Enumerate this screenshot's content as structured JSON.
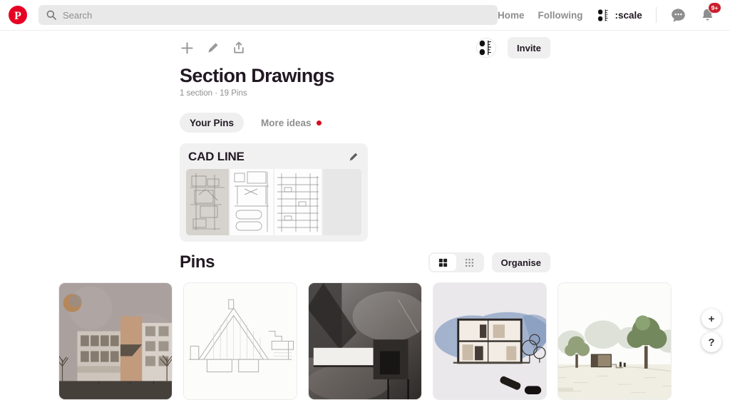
{
  "colors": {
    "brand_red": "#e60023",
    "badge_red": "#ca1f2e",
    "new_dot_red": "#d50c22",
    "icon_gray": "#8e8e8e",
    "chip_gray": "#efefef",
    "section_card_gray": "#f1f1f1"
  },
  "topbar": {
    "logo_glyph": "P",
    "search_placeholder": "Search",
    "nav_home": "Home",
    "nav_following": "Following",
    "username": ":scale",
    "notification_badge": "9+"
  },
  "board": {
    "title": "Section Drawings",
    "meta": "1 section · 19 Pins",
    "invite_label": "Invite",
    "tabs": [
      {
        "label": "Your Pins",
        "selected": true
      },
      {
        "label": "More ideas",
        "has_new_dot": true
      }
    ],
    "section": {
      "title": "CAD LINE",
      "thumbnails": [
        "cad-sketch-on-gray-paper",
        "cad-plan-with-rounded-pools",
        "cad-building-section"
      ]
    }
  },
  "pins_section": {
    "heading": "Pins",
    "organise_label": "Organise",
    "view_modes": [
      "large-grid",
      "small-grid"
    ],
    "pins": [
      {
        "name": "elevation-render-with-moon-and-trees"
      },
      {
        "name": "thin-line-house-section-drawing"
      },
      {
        "name": "charcoal-architectural-section"
      },
      {
        "name": "blue-watercolor-house-section"
      },
      {
        "name": "landscape-render-with-green-trees"
      }
    ]
  },
  "fabs": {
    "add_label": "+",
    "help_label": "?"
  }
}
